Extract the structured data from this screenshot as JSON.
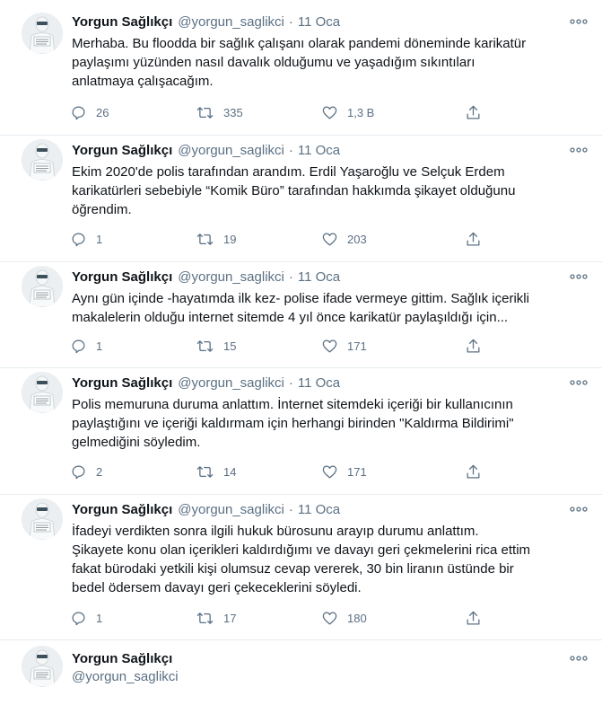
{
  "author": {
    "name": "Yorgun Sağlıkçı",
    "handle": "@yorgun_saglikci",
    "dot": "·"
  },
  "tweets": [
    {
      "date": "11 Oca",
      "text": "Merhaba. Bu floodda bir sağlık çalışanı olarak pandemi döneminde karikatür\npaylaşımı yüzünden nasıl davalık olduğumu ve yaşadığım sıkıntıları\nanlatmaya çalışacağım.",
      "replies": "26",
      "retweets": "335",
      "likes": "1,3 B"
    },
    {
      "date": "11 Oca",
      "text": "Ekim 2020'de polis tarafından arandım. Erdil Yaşaroğlu ve Selçuk Erdem\nkarikatürleri sebebiyle “Komik Büro” tarafından hakkımda şikayet olduğunu\nöğrendim.",
      "replies": "1",
      "retweets": "19",
      "likes": "203"
    },
    {
      "date": "11 Oca",
      "text": "Aynı gün içinde -hayatımda ilk kez- polise ifade vermeye gittim. Sağlık içerikli\nmakalelerin olduğu internet sitemde 4 yıl önce karikatür paylaşıldığı için...",
      "replies": "1",
      "retweets": "15",
      "likes": "171"
    },
    {
      "date": "11 Oca",
      "text": "Polis memuruna duruma anlattım. İnternet sitemdeki içeriği bir kullanıcının\npaylaştığını ve içeriği kaldırmam için herhangi birinden \"Kaldırma Bildirimi\"\ngelmediğini söyledim.",
      "replies": "2",
      "retweets": "14",
      "likes": "171"
    },
    {
      "date": "11 Oca",
      "text": "İfadeyi verdikten sonra ilgili hukuk bürosunu arayıp durumu anlattım.\nŞikayete konu olan içerikleri kaldırdığımı ve davayı geri çekmelerini rica ettim\nfakat bürodaki yetkili kişi olumsuz cevap vererek, 30 bin liranın üstünde bir\nbedel ödersem davayı geri çekeceklerini söyledi.",
      "replies": "1",
      "retweets": "17",
      "likes": "180"
    }
  ],
  "colors": {
    "text": "#0f1419",
    "muted": "#5b7083",
    "divider": "#e6ecf0"
  },
  "icons": [
    "reply-icon",
    "retweet-icon",
    "like-icon",
    "share-icon",
    "more-icon"
  ]
}
